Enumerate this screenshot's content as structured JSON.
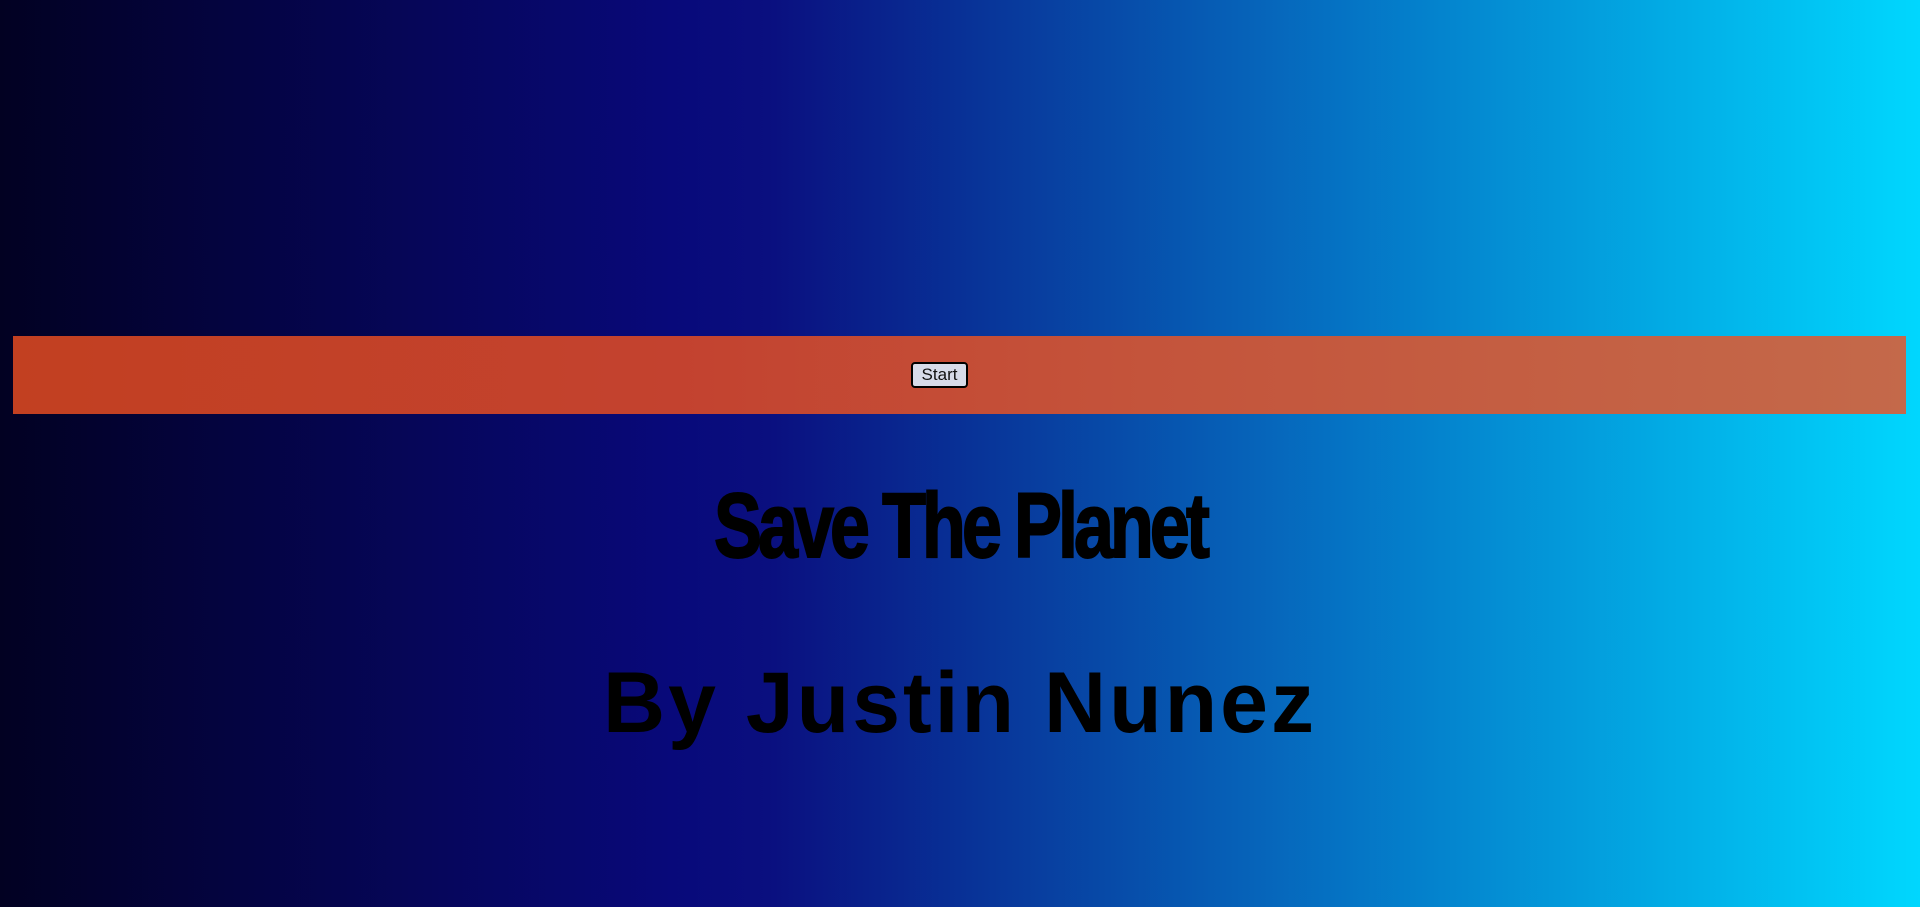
{
  "menu": {
    "start_label": "Start"
  },
  "title": "Save The Planet",
  "author": "By Justin Nunez",
  "colors": {
    "background_left": "#020122",
    "background_mid": "#08097a",
    "background_right": "#00d7fe",
    "bar_left": "#c24021",
    "bar_right": "#c4694a",
    "text": "#000000",
    "button_bg": "#d7dbe9"
  }
}
